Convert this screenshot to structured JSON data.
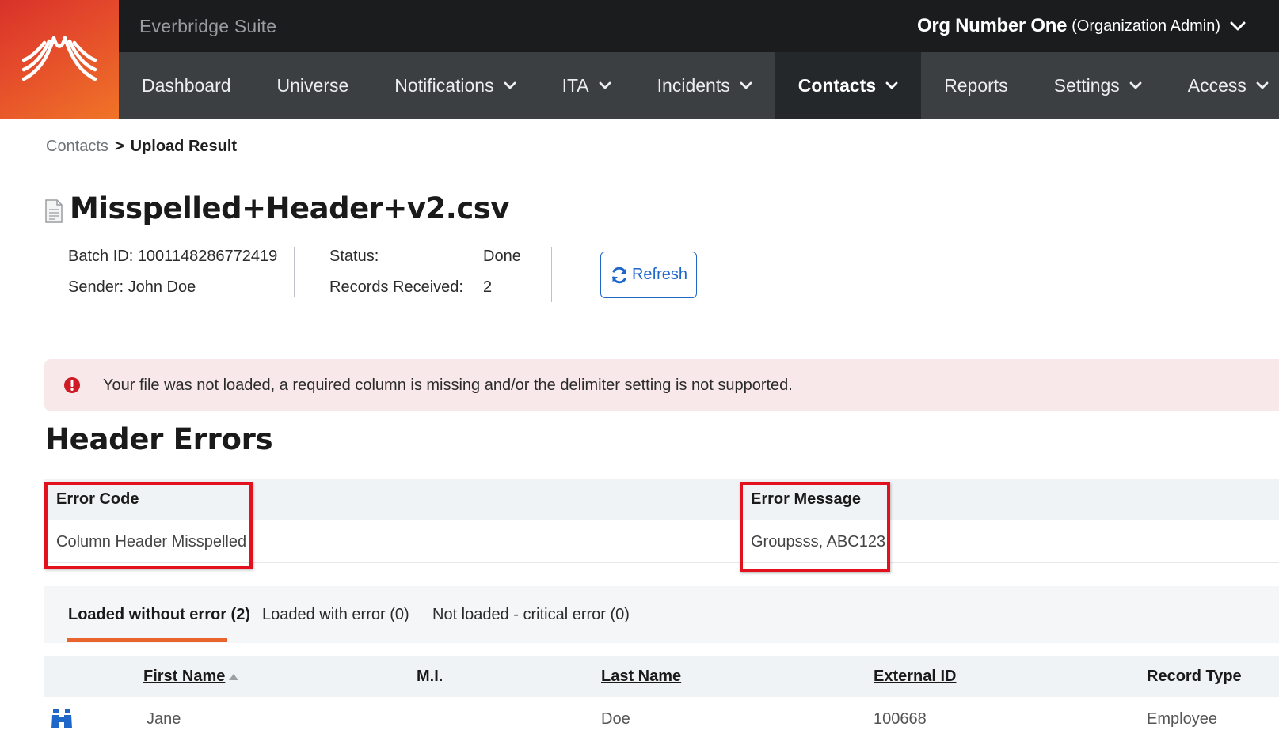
{
  "app": {
    "suite_name": "Everbridge Suite",
    "org_name": "Org Number One",
    "org_role": "(Organization Admin)",
    "brand_color": "#e44a2b"
  },
  "nav": {
    "items": [
      {
        "label": "Dashboard",
        "has_dropdown": false,
        "active": false
      },
      {
        "label": "Universe",
        "has_dropdown": false,
        "active": false
      },
      {
        "label": "Notifications",
        "has_dropdown": true,
        "active": false
      },
      {
        "label": "ITA",
        "has_dropdown": true,
        "active": false
      },
      {
        "label": "Incidents",
        "has_dropdown": true,
        "active": false
      },
      {
        "label": "Contacts",
        "has_dropdown": true,
        "active": true
      },
      {
        "label": "Reports",
        "has_dropdown": false,
        "active": false
      },
      {
        "label": "Settings",
        "has_dropdown": true,
        "active": false
      },
      {
        "label": "Access",
        "has_dropdown": true,
        "active": false
      }
    ]
  },
  "breadcrumb": {
    "parent": "Contacts",
    "separator": ">",
    "current": "Upload Result"
  },
  "file": {
    "icon": "document-icon",
    "name": "Misspelled+Header+v2.csv"
  },
  "batch": {
    "batch_id": "Batch ID: 1001148286772419",
    "sender": "Sender: John Doe",
    "status_label": "Status:",
    "status_value": "Done",
    "records_label": "Records Received:",
    "records_value": "2",
    "refresh_label": "Refresh"
  },
  "alert": {
    "icon": "error-icon",
    "message": "Your file was not loaded, a required column is missing and/or the delimiter setting is not supported."
  },
  "header_errors": {
    "title": "Header Errors",
    "columns": [
      "Error Code",
      "Error Message"
    ],
    "rows": [
      {
        "code": "Column Header Misspelled",
        "message": "Groupsss, ABC123"
      }
    ]
  },
  "tabs": [
    {
      "label": "Loaded without error (2)",
      "active": true
    },
    {
      "label": "Loaded with error (0)",
      "active": false
    },
    {
      "label": "Not loaded - critical error (0)",
      "active": false
    }
  ],
  "contacts_table": {
    "columns": [
      "First Name",
      "M.I.",
      "Last Name",
      "External ID",
      "Record Type"
    ],
    "rows": [
      {
        "icon": "binoculars-icon",
        "first_name": "Jane",
        "mi": "",
        "last_name": "Doe",
        "external_id": "100668",
        "record_type": "Employee"
      }
    ]
  }
}
